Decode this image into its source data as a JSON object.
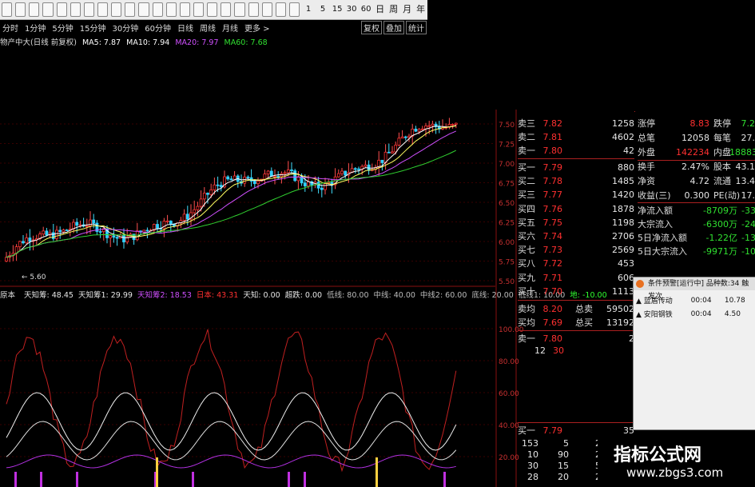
{
  "toolbar": {
    "icons": [
      "back-icon",
      "forward-icon",
      "home-icon",
      "grid-icon",
      "chart-icon",
      "bar-icon",
      "calendar-icon",
      "candle-icon",
      "zoom-in-icon",
      "zoom-out-icon",
      "pan-icon",
      "book-icon",
      "search-icon",
      "draw-icon",
      "cross-icon",
      "rsi-icon",
      "info-icon",
      "up-icon",
      "move-icon",
      "star-icon",
      "list-icon",
      "grid2-icon"
    ],
    "numbers": [
      "1",
      "5",
      "15",
      "30",
      "60"
    ],
    "periods": [
      "日",
      "周",
      "月",
      "年"
    ]
  },
  "period_bar": {
    "items": [
      "分时",
      "1分钟",
      "5分钟",
      "15分钟",
      "30分钟",
      "60分钟",
      "日线",
      "周线",
      "月线",
      "更多 >"
    ],
    "right": [
      "复权",
      "叠加",
      "统计"
    ]
  },
  "ma_line": {
    "title": "物产中大(日线 前复权)",
    "ma5": "MA5: 7.87",
    "ma10": "MA10: 7.94",
    "ma20": "MA20: 7.97",
    "ma60": "MA60: 7.68"
  },
  "indicator_header": {
    "name": "原本",
    "items": [
      {
        "text": "天知筹: 48.45",
        "color": "#e6e6e6"
      },
      {
        "text": "天知筹1: 29.99",
        "color": "#e6e6e6"
      },
      {
        "text": "天知筹2: 18.53",
        "color": "#d050ff"
      },
      {
        "text": "日本: 43.31",
        "color": "#ff3030"
      },
      {
        "text": "天知: 0.00",
        "color": "#e6e6e6"
      },
      {
        "text": "超跌: 0.00",
        "color": "#e6e6e6"
      },
      {
        "text": "低线: 80.00",
        "color": "#bbbbbb"
      },
      {
        "text": "中线: 40.00",
        "color": "#bbbbbb"
      },
      {
        "text": "中线2: 60.00",
        "color": "#bbbbbb"
      },
      {
        "text": "底线: 20.00",
        "color": "#bbbbbb"
      },
      {
        "text": "低线1: 10.00",
        "color": "#bbbbbb"
      },
      {
        "text": "地: -10.00",
        "color": "#30ff30"
      }
    ]
  },
  "price_axis": [
    "7.50",
    "7.25",
    "7.00",
    "6.75",
    "6.50",
    "6.25",
    "6.00",
    "5.75",
    "5.50"
  ],
  "ind_axis": [
    "100.00",
    "80.00",
    "60.00",
    "40.00",
    "20.00"
  ],
  "price_low_label": "5.60",
  "quote": {
    "sell": [
      {
        "label": "卖三",
        "price": "7.82",
        "vol": "1258"
      },
      {
        "label": "卖二",
        "price": "7.81",
        "vol": "4602"
      },
      {
        "label": "卖一",
        "price": "7.80",
        "vol": "42"
      }
    ],
    "buy": [
      {
        "label": "买一",
        "price": "7.79",
        "vol": "880"
      },
      {
        "label": "买二",
        "price": "7.78",
        "vol": "1485"
      },
      {
        "label": "买三",
        "price": "7.77",
        "vol": "1420"
      },
      {
        "label": "买四",
        "price": "7.76",
        "vol": "1878"
      },
      {
        "label": "买五",
        "price": "7.75",
        "vol": "1198"
      },
      {
        "label": "买六",
        "price": "7.74",
        "vol": "2706"
      },
      {
        "label": "买七",
        "price": "7.73",
        "vol": "2569"
      },
      {
        "label": "买八",
        "price": "7.72",
        "vol": "453"
      },
      {
        "label": "买九",
        "price": "7.71",
        "vol": "606"
      },
      {
        "label": "买十",
        "price": "7.70",
        "vol": "1113"
      }
    ],
    "stats": [
      {
        "l1": "涨停",
        "v1": "8.83",
        "l2": "跌停",
        "v2": "7.2"
      },
      {
        "l1": "总笔",
        "v1": "12058",
        "l2": "每笔",
        "v2": "27."
      },
      {
        "l1": "外盘",
        "v1": "142234",
        "l2": "内盘",
        "v2": "18883"
      },
      {
        "l1": "换手",
        "v1": "2.47%",
        "l2": "股本",
        "v2": "43.1"
      },
      {
        "l1": "净资",
        "v1": "4.72",
        "l2": "流通",
        "v2": "13.4"
      },
      {
        "l1": "收益(三)",
        "v1": "0.300",
        "l2": "PE(动)",
        "v2": "17."
      }
    ],
    "flows": [
      {
        "label": "净流入额",
        "value": "-8709万",
        "extra": "-33"
      },
      {
        "label": "大宗流入",
        "value": "-6300万",
        "extra": "-24"
      },
      {
        "label": "5日净流入额",
        "value": "-1.22亿",
        "extra": "-13"
      },
      {
        "label": "5日大宗流入",
        "value": "-9971万",
        "extra": "-10"
      }
    ],
    "sell_avg": {
      "label": "卖均",
      "price": "8.20",
      "label2": "总卖",
      "vol": "59502"
    },
    "buy_avg": {
      "label": "买均",
      "price": "7.69",
      "label2": "总买",
      "vol": "13192"
    },
    "last_sell": {
      "label": "卖一",
      "price": "7.80",
      "vol": "2"
    },
    "tick": {
      "a": "12",
      "b": "30"
    },
    "bottom_buy": {
      "label": "买一",
      "price": "7.79",
      "vol": "35"
    },
    "trades": [
      [
        "153",
        "5",
        "2"
      ],
      [
        "10",
        "90",
        "2"
      ],
      [
        "30",
        "15",
        "5"
      ],
      [
        "28",
        "20",
        "2"
      ]
    ]
  },
  "alert": {
    "title": "条件预警[运行中] 品种数:34 触发次",
    "rows": [
      {
        "name": "蓝盾传动",
        "time": "00:04",
        "value": "10.78"
      },
      {
        "name": "安阳钢铁",
        "time": "00:04",
        "value": "4.50"
      }
    ]
  },
  "watermark": {
    "line1": "指标公式网",
    "line2": "www.zbgs3.com"
  }
}
